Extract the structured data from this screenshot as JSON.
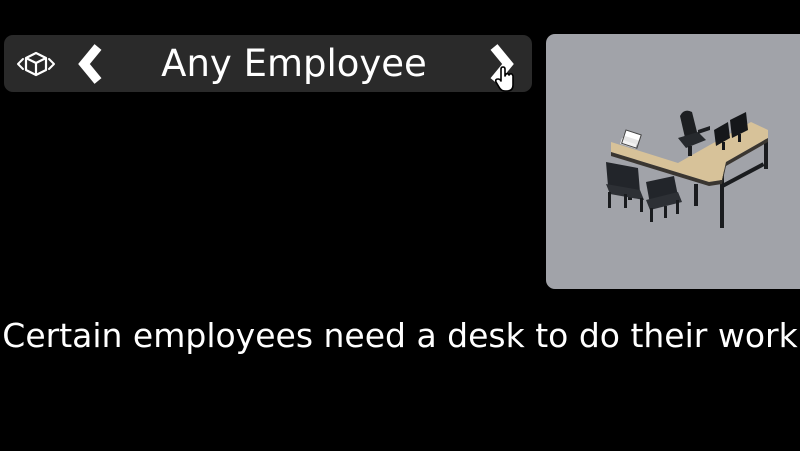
{
  "selector": {
    "label": "Any Employee",
    "view_toggle_icon": "3d-cube-view-icon",
    "prev_icon": "chevron-left-icon",
    "next_icon": "chevron-right-icon",
    "cursor_icon": "hand-pointer-icon"
  },
  "preview": {
    "image": "l-shaped-office-desk-with-chairs",
    "background": "#a1a3a9"
  },
  "description": {
    "text": "Certain employees need a desk to do their work"
  },
  "colors": {
    "background": "#000000",
    "bar": "#2a2a2a",
    "text": "#ffffff"
  }
}
